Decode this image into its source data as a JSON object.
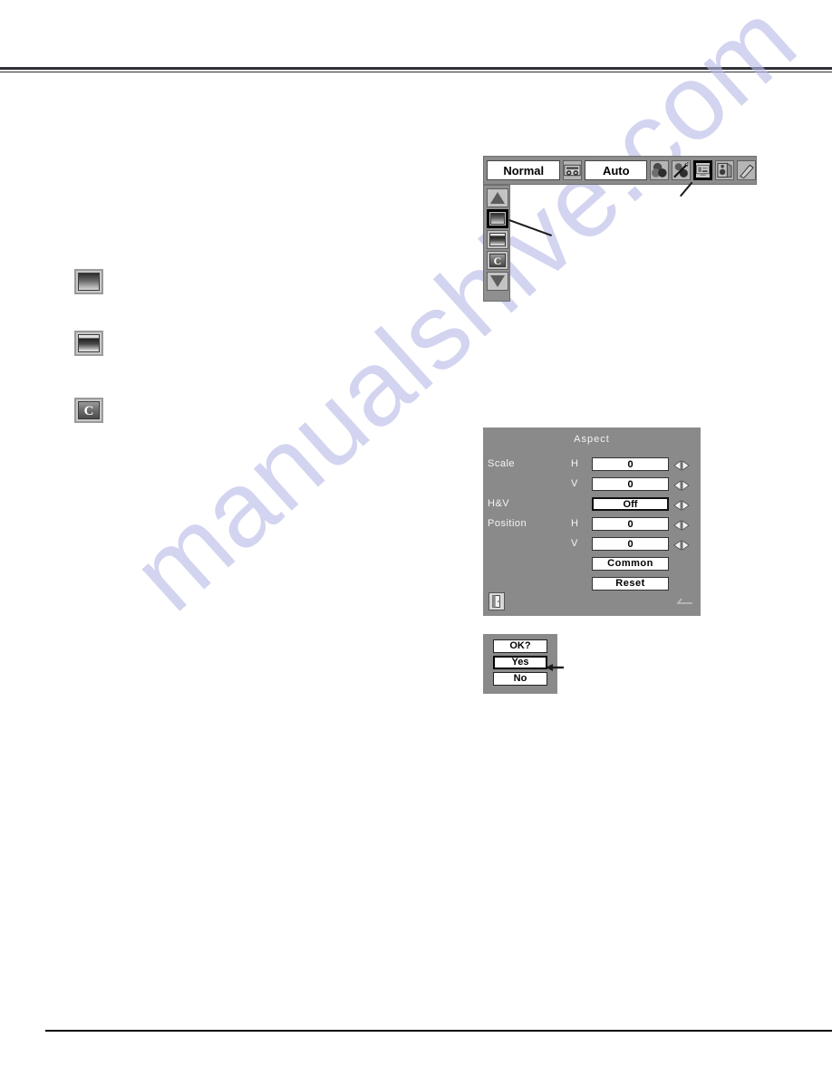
{
  "page": {
    "watermark": "manualshive.com"
  },
  "margin_icons": [
    {
      "name": "screen-normal-icon",
      "glyph": "screen-full"
    },
    {
      "name": "screen-wide-icon",
      "glyph": "screen-wide"
    },
    {
      "name": "screen-custom-icon",
      "glyph": "C"
    }
  ],
  "osd_menubar": {
    "input_mode_value": "Normal",
    "system_value": "Auto",
    "icons": [
      {
        "name": "input-source-icon",
        "label": "input-source",
        "selected": false
      },
      {
        "name": "color-adjust-icon",
        "label": "color-adjust",
        "selected": false
      },
      {
        "name": "image-adjust-icon",
        "label": "image-adjust",
        "selected": false
      },
      {
        "name": "screen-aspect-icon",
        "label": "screen-aspect",
        "selected": true
      },
      {
        "name": "sound-icon",
        "label": "sound",
        "selected": false
      },
      {
        "name": "setting-icon",
        "label": "setting",
        "selected": false
      }
    ]
  },
  "osd_sidebar": {
    "items": [
      {
        "name": "scroll-up-button",
        "glyph": "triangle-up",
        "selected": false
      },
      {
        "name": "screen-normal-item",
        "glyph": "screen-full",
        "selected": true
      },
      {
        "name": "screen-wide-item",
        "glyph": "screen-wide",
        "selected": false
      },
      {
        "name": "screen-custom-item",
        "glyph": "C",
        "selected": false
      },
      {
        "name": "scroll-down-button",
        "glyph": "triangle-down",
        "selected": false
      }
    ]
  },
  "aspect_dialog": {
    "title": "Aspect",
    "rows": [
      {
        "label": "Scale",
        "sub": "H",
        "value": "0",
        "thick": false
      },
      {
        "label": "",
        "sub": "V",
        "value": "0",
        "thick": false
      },
      {
        "label": "H&V",
        "sub": "",
        "value": "Off",
        "thick": true
      },
      {
        "label": "Position",
        "sub": "H",
        "value": "0",
        "thick": false
      },
      {
        "label": "",
        "sub": "V",
        "value": "0",
        "thick": false
      }
    ],
    "common_label": "Common",
    "reset_label": "Reset",
    "exit_icon": "exit-door-icon",
    "back_icon": "back-arrow-icon"
  },
  "confirm_dialog": {
    "question": "OK?",
    "yes_label": "Yes",
    "no_label": "No",
    "pointer_icon": "left-arrow-pointer-icon"
  },
  "colors": {
    "osd_panel": "#8a8a8a",
    "osd_menubar": "#8c8c8c",
    "field_bg": "#ffffff",
    "selection_border": "#000000",
    "watermark": "#b9bbe8",
    "rule": "#2f3136"
  }
}
